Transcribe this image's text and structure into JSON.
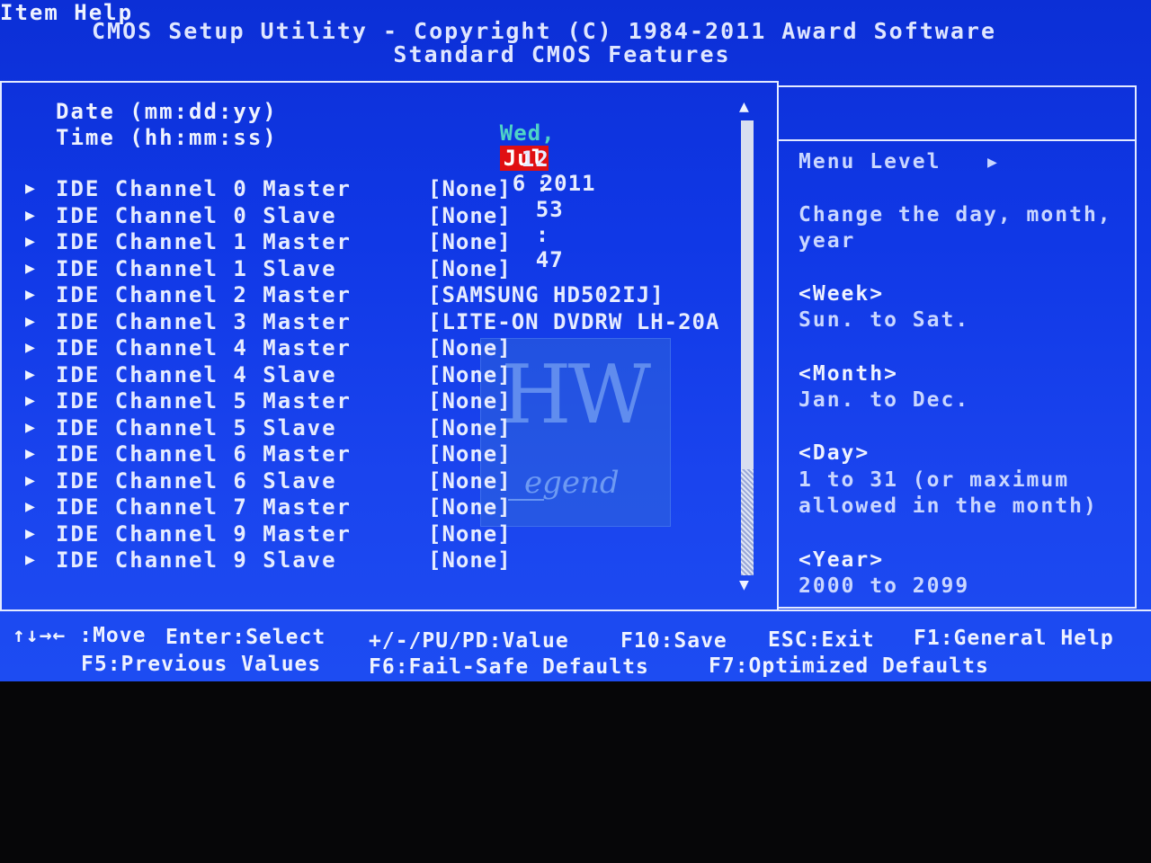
{
  "header": {
    "line1": "CMOS Setup Utility - Copyright (C) 1984-2011 Award Software",
    "line2": "Standard CMOS Features"
  },
  "datetime": {
    "date_label": "Date (mm:dd:yy)",
    "time_label": "Time (hh:mm:ss)",
    "day_of_week": "Wed,",
    "month": "Jul",
    "day_year": "6 2011",
    "hour": "12",
    "minute": "53",
    "second": "47",
    "sep": ":"
  },
  "channels": [
    {
      "label": "IDE Channel 0 Master",
      "value": "[None]"
    },
    {
      "label": "IDE Channel 0 Slave",
      "value": "[None]"
    },
    {
      "label": "IDE Channel 1 Master",
      "value": "[None]"
    },
    {
      "label": "IDE Channel 1 Slave",
      "value": "[None]"
    },
    {
      "label": "IDE Channel 2 Master",
      "value": "[SAMSUNG HD502IJ]"
    },
    {
      "label": "IDE Channel 3 Master",
      "value": "[LITE-ON DVDRW LH-20A"
    },
    {
      "label": "IDE Channel 4 Master",
      "value": "[None]"
    },
    {
      "label": "IDE Channel 4 Slave",
      "value": "[None]"
    },
    {
      "label": "IDE Channel 5 Master",
      "value": "[None]"
    },
    {
      "label": "IDE Channel 5 Slave",
      "value": "[None]"
    },
    {
      "label": "IDE Channel 6 Master",
      "value": "[None]"
    },
    {
      "label": "IDE Channel 6 Slave",
      "value": "[None]"
    },
    {
      "label": "IDE Channel 7 Master",
      "value": "[None]"
    },
    {
      "label": "IDE Channel 9 Master",
      "value": "[None]"
    },
    {
      "label": "IDE Channel 9 Slave",
      "value": "[None]"
    }
  ],
  "help": {
    "title": "Item Help",
    "menu_level": "Menu Level",
    "menu_level_arrow": "▶",
    "lines": [
      "Change the day, month,",
      "year",
      "<Week>",
      "Sun. to Sat.",
      "<Month>",
      "Jan. to Dec.",
      "<Day>",
      "1 to 31 (or maximum",
      "allowed in the month)",
      "<Year>",
      "2000 to 2099"
    ]
  },
  "footer": {
    "move": "↑↓→← :Move",
    "enter": "Enter:Select",
    "value": "+/-/PU/PD:Value",
    "save": "F10:Save",
    "exit": "ESC:Exit",
    "general_help": "F1:General Help",
    "previous": "F5:Previous Values",
    "failsafe": "F6:Fail-Safe Defaults",
    "optimized": "F7:Optimized Defaults"
  },
  "watermark": {
    "big": "HW",
    "small": "egend"
  },
  "row_arrow": "▶",
  "scroll": {
    "up": "▲",
    "down": "▼"
  },
  "colors": {
    "screen_blue": "#1038e6",
    "highlight_red": "#e00f12",
    "dow_cyan": "#4fd3c7",
    "text": "#e6ecff"
  }
}
